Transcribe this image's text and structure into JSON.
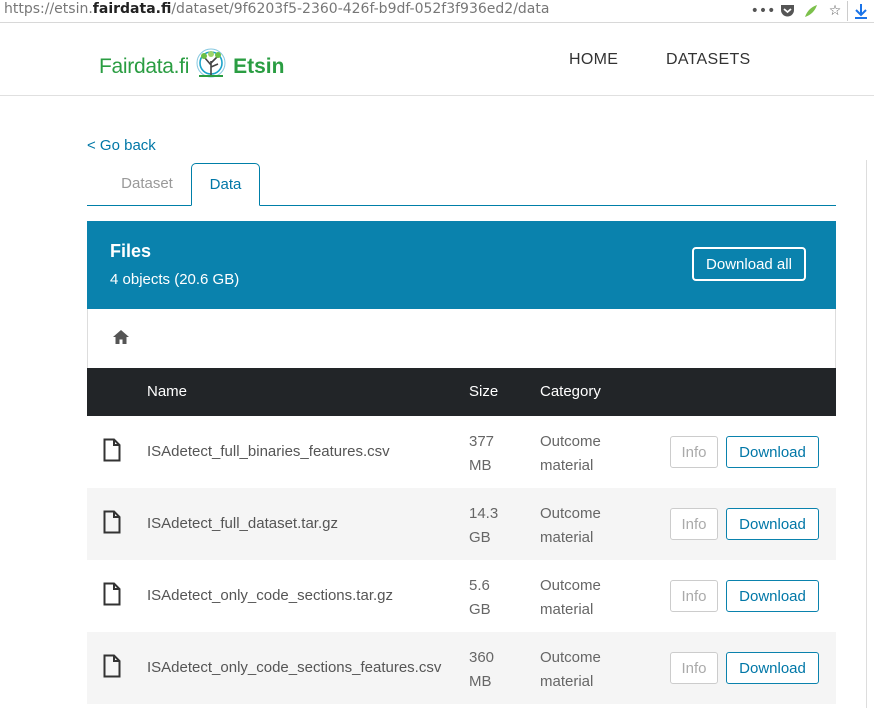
{
  "browser": {
    "url_prefix": "https://etsin.",
    "url_host": "fairdata.fi",
    "url_path": "/dataset/9f6203f5-2360-426f-b9df-052f3f936ed2/data",
    "icons": [
      "more-icon",
      "pocket-icon",
      "extension-icon",
      "bookmark-star-icon",
      "download-arrow-icon"
    ]
  },
  "header": {
    "logo_left": "Fairdata.fi",
    "logo_right": "Etsin",
    "nav": [
      "HOME",
      "DATASETS"
    ]
  },
  "page": {
    "go_back": "< Go back",
    "tabs": [
      "Dataset",
      "Data"
    ],
    "active_tab": "Data"
  },
  "files": {
    "title": "Files",
    "count": "4 objects (20.6 GB)",
    "download_all": "Download all",
    "header_color": "#0a82ad",
    "columns": [
      "Name",
      "Size",
      "Category"
    ],
    "rows": [
      {
        "name": "ISAdetect_full_binaries_features.csv",
        "size1": "377",
        "size2": "MB",
        "cat1": "Outcome",
        "cat2": "material",
        "info": "Info",
        "download": "Download"
      },
      {
        "name": "ISAdetect_full_dataset.tar.gz",
        "size1": "14.3",
        "size2": "GB",
        "cat1": "Outcome",
        "cat2": "material",
        "info": "Info",
        "download": "Download"
      },
      {
        "name": "ISAdetect_only_code_sections.tar.gz",
        "size1": "5.6",
        "size2": "GB",
        "cat1": "Outcome",
        "cat2": "material",
        "info": "Info",
        "download": "Download"
      },
      {
        "name": "ISAdetect_only_code_sections_features.csv",
        "size1": "360",
        "size2": "MB",
        "cat1": "Outcome",
        "cat2": "material",
        "info": "Info",
        "download": "Download"
      }
    ]
  }
}
